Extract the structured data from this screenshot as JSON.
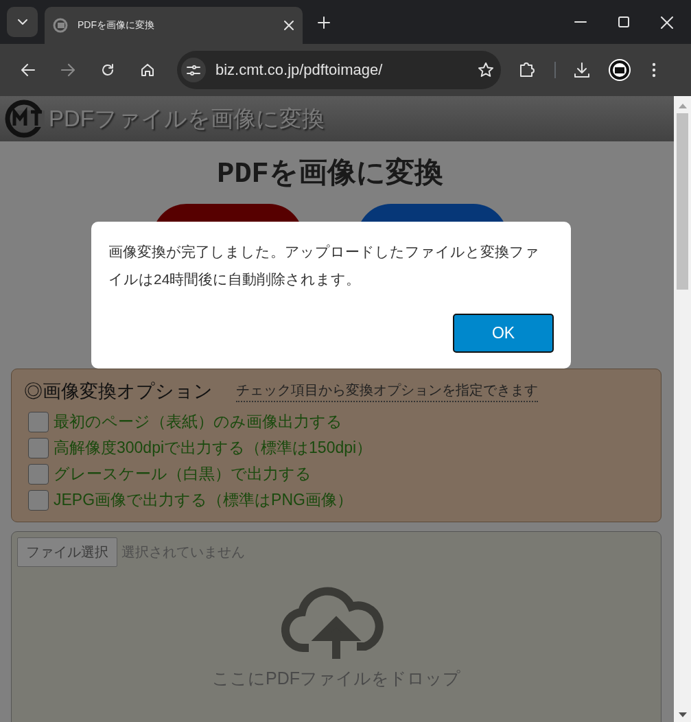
{
  "browser": {
    "tab_title": "PDFを画像に変換",
    "address": "biz.cmt.co.jp/pdftoimage/"
  },
  "site_header": {
    "title": "PDFファイルを画像に変換"
  },
  "page": {
    "heading": "PDFを画像に変換"
  },
  "options": {
    "heading": "◎画像変換オプション",
    "hint": "チェック項目から変換オプションを指定できます",
    "items": [
      {
        "label": "最初のページ（表紙）のみ画像出力する",
        "checked": false
      },
      {
        "label": "高解像度300dpiで出力する（標準は150dpi）",
        "checked": false
      },
      {
        "label": "グレースケール（白黒）で出力する",
        "checked": false
      },
      {
        "label": "JEPG画像で出力する（標準はPNG画像）",
        "checked": false
      }
    ]
  },
  "upload": {
    "button": "ファイル選択",
    "status": "選択されていません",
    "drop_text": "ここにPDFファイルをドロップ"
  },
  "dialog": {
    "message": "画像変換が完了しました。アップロードしたファイルと変換ファイルは24時間後に自動削除されます。",
    "button": "OK"
  }
}
